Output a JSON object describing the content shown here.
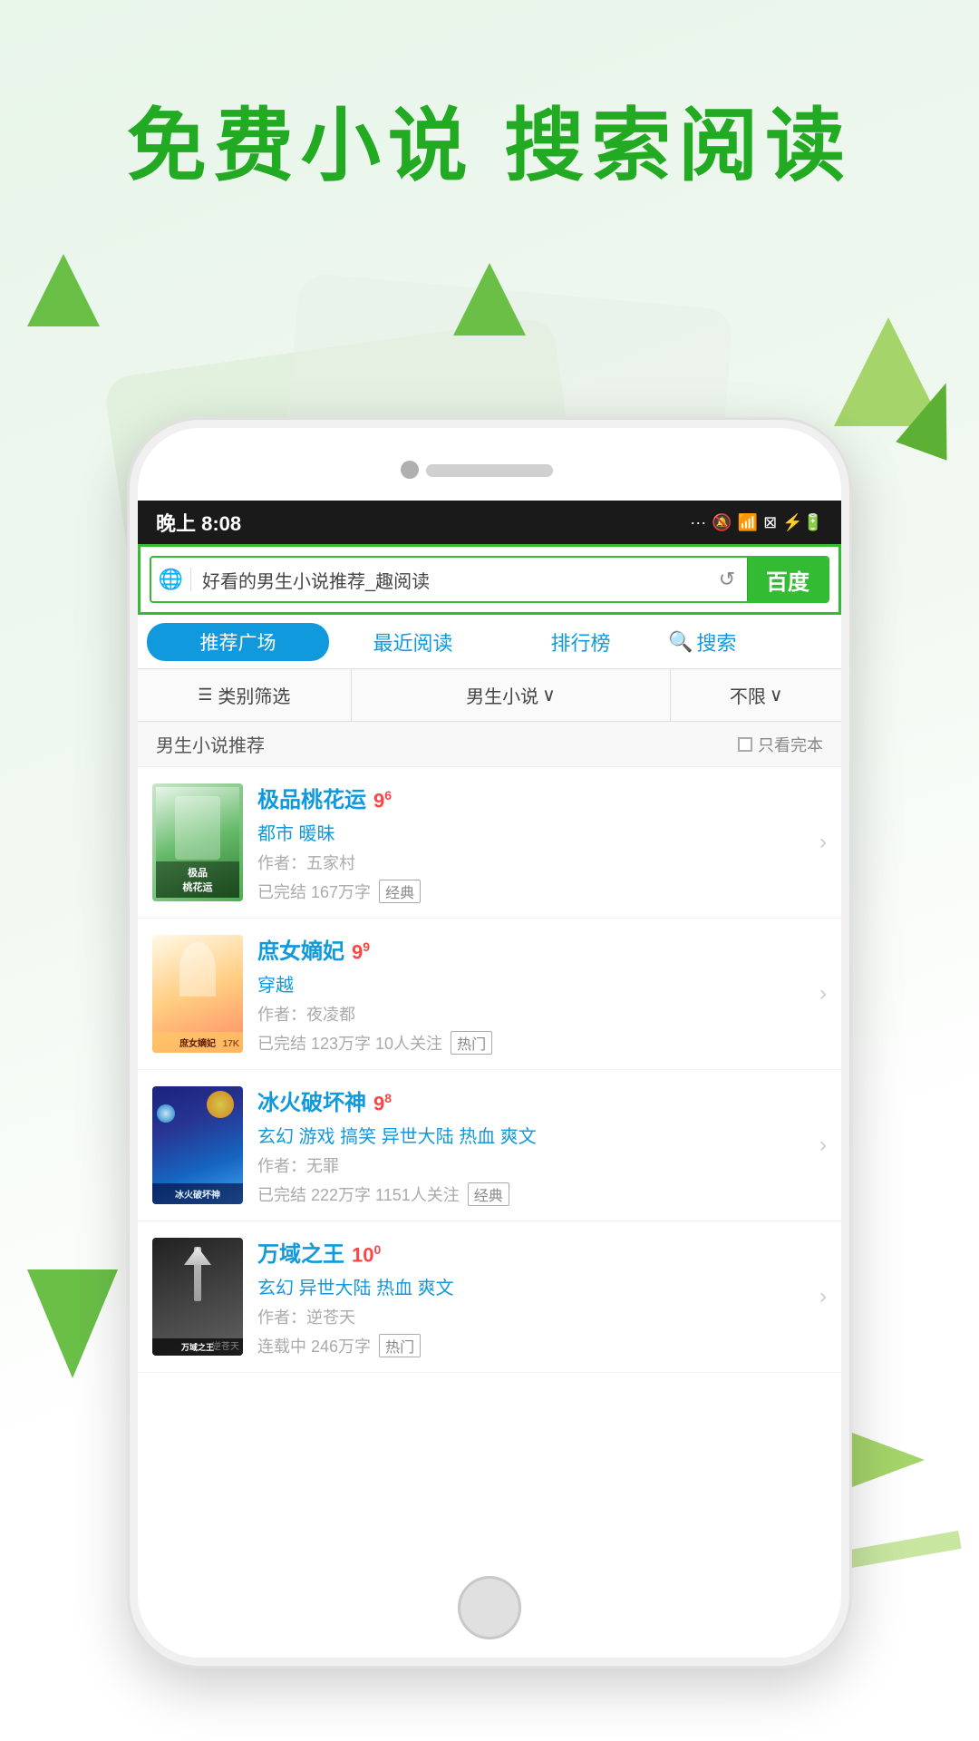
{
  "header": {
    "title": "免费小说  搜索阅读"
  },
  "status_bar": {
    "time": "晚上 8:08",
    "signal": "···",
    "mute_icon": "🔇",
    "wifi_icon": "📶",
    "sim_icon": "📱",
    "battery_icon": "🔋"
  },
  "search_bar": {
    "globe_icon": "🌐",
    "placeholder": "好看的男生小说推荐_趣阅读",
    "refresh_icon": "↺",
    "baidu_label": "百度"
  },
  "tabs": [
    {
      "label": "推荐广场",
      "active": true
    },
    {
      "label": "最近阅读",
      "active": false
    },
    {
      "label": "排行榜",
      "active": false
    },
    {
      "label": "搜索",
      "active": false,
      "has_icon": true
    }
  ],
  "filter": {
    "category_icon": "☰",
    "category_label": "类别筛选",
    "genre_label": "男生小说",
    "genre_arrow": "∨",
    "status_label": "不限",
    "status_arrow": "∨"
  },
  "section": {
    "title": "男生小说推荐",
    "only_complete_label": "只看完本"
  },
  "books": [
    {
      "title": "极品桃花运",
      "rating": "9",
      "rating_sup": "6",
      "genre": "都市 暖昧",
      "author": "作者：五家村",
      "meta": "已完结 167万字",
      "tag": "经典",
      "cover_style": "1"
    },
    {
      "title": "庶女嫡妃",
      "rating": "9",
      "rating_sup": "9",
      "genre": "穿越",
      "author": "作者：夜凌都",
      "meta": "已完结 123万字 10人关注",
      "tag": "热门",
      "cover_style": "2",
      "cover_watermark": "17K"
    },
    {
      "title": "冰火破坏神",
      "rating": "9",
      "rating_sup": "8",
      "genre": "玄幻 游戏 搞笑 异世大陆 热血 爽文",
      "author": "作者：无罪",
      "meta": "已完结 222万字 1151人关注",
      "tag": "经典",
      "cover_style": "3"
    },
    {
      "title": "万域之王",
      "rating": "10",
      "rating_sup": "0",
      "genre": "玄幻 异世大陆 热血 爽文",
      "author": "作者：逆苍天",
      "meta": "连载中 246万字",
      "tag": "热门",
      "cover_style": "4",
      "cover_watermark": "逆苍天"
    }
  ]
}
